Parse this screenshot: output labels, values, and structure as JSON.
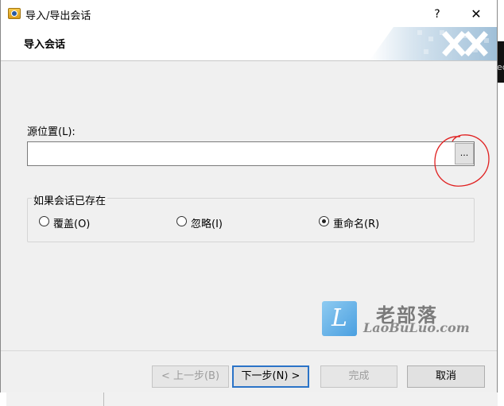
{
  "window": {
    "title": "导入/导出会话",
    "help_glyph": "?",
    "close_glyph": "✕"
  },
  "header": {
    "title": "导入会话"
  },
  "source": {
    "label": "源位置(L):",
    "value": "",
    "browse_label": "..."
  },
  "if_exists": {
    "title": "如果会话已存在",
    "options": [
      {
        "label": "覆盖(O)",
        "selected": false
      },
      {
        "label": "忽略(I)",
        "selected": false
      },
      {
        "label": "重命名(R)",
        "selected": true
      }
    ]
  },
  "watermark": {
    "badge": "L",
    "chinese": "老部落",
    "english": "LaoBuLuo.com"
  },
  "buttons": {
    "back": "< 上一步(B)",
    "next": "下一步(N) >",
    "finish": "完成",
    "cancel": "取消"
  },
  "colors": {
    "default_button_border": "#2b73c7",
    "annotation": "#e02020",
    "watermark_blue": "#4a9fe0"
  }
}
